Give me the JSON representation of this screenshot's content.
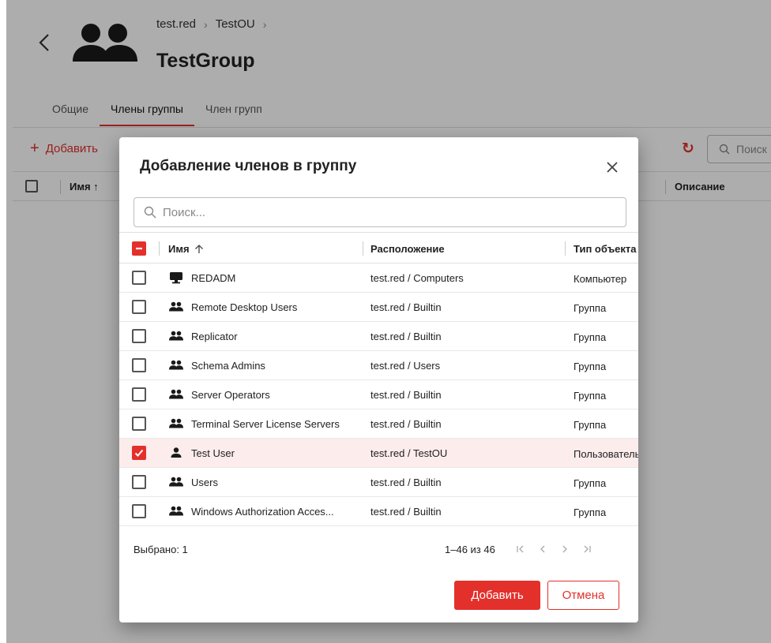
{
  "colors": {
    "accent": "#e3302b",
    "selected_row": "#fdecec"
  },
  "page": {
    "breadcrumb": [
      "test.red",
      "TestOU"
    ],
    "breadcrumb_sep": "›",
    "title": "TestGroup",
    "tabs": [
      {
        "label": "Общие",
        "active": false
      },
      {
        "label": "Члены группы",
        "active": true
      },
      {
        "label": "Член групп",
        "active": false
      }
    ],
    "add_label": "Добавить",
    "search_placeholder": "Поиск",
    "columns": {
      "name": "Имя",
      "description": "Описание"
    }
  },
  "dialog": {
    "title": "Добавление членов в группу",
    "search_placeholder": "Поиск...",
    "columns": {
      "name": "Имя",
      "location": "Расположение",
      "type": "Тип объекта"
    },
    "rows": [
      {
        "icon": "computer-icon",
        "name": "REDADM",
        "location": "test.red / Computers",
        "type": "Компьютер",
        "checked": false
      },
      {
        "icon": "group-icon",
        "name": "Remote Desktop Users",
        "location": "test.red / Builtin",
        "type": "Группа",
        "checked": false
      },
      {
        "icon": "group-icon",
        "name": "Replicator",
        "location": "test.red / Builtin",
        "type": "Группа",
        "checked": false
      },
      {
        "icon": "group-icon",
        "name": "Schema Admins",
        "location": "test.red / Users",
        "type": "Группа",
        "checked": false
      },
      {
        "icon": "group-icon",
        "name": "Server Operators",
        "location": "test.red / Builtin",
        "type": "Группа",
        "checked": false
      },
      {
        "icon": "group-icon",
        "name": "Terminal Server License Servers",
        "location": "test.red / Builtin",
        "type": "Группа",
        "checked": false
      },
      {
        "icon": "user-icon",
        "name": "Test User",
        "location": "test.red / TestOU",
        "type": "Пользователь",
        "checked": true
      },
      {
        "icon": "group-icon",
        "name": "Users",
        "location": "test.red / Builtin",
        "type": "Группа",
        "checked": false
      },
      {
        "icon": "group-icon",
        "name": "Windows Authorization Acces...",
        "location": "test.red / Builtin",
        "type": "Группа",
        "checked": false
      }
    ],
    "selected_label": "Выбрано: 1",
    "range_label": "1–46 из 46",
    "add_button": "Добавить",
    "cancel_button": "Отмена"
  }
}
